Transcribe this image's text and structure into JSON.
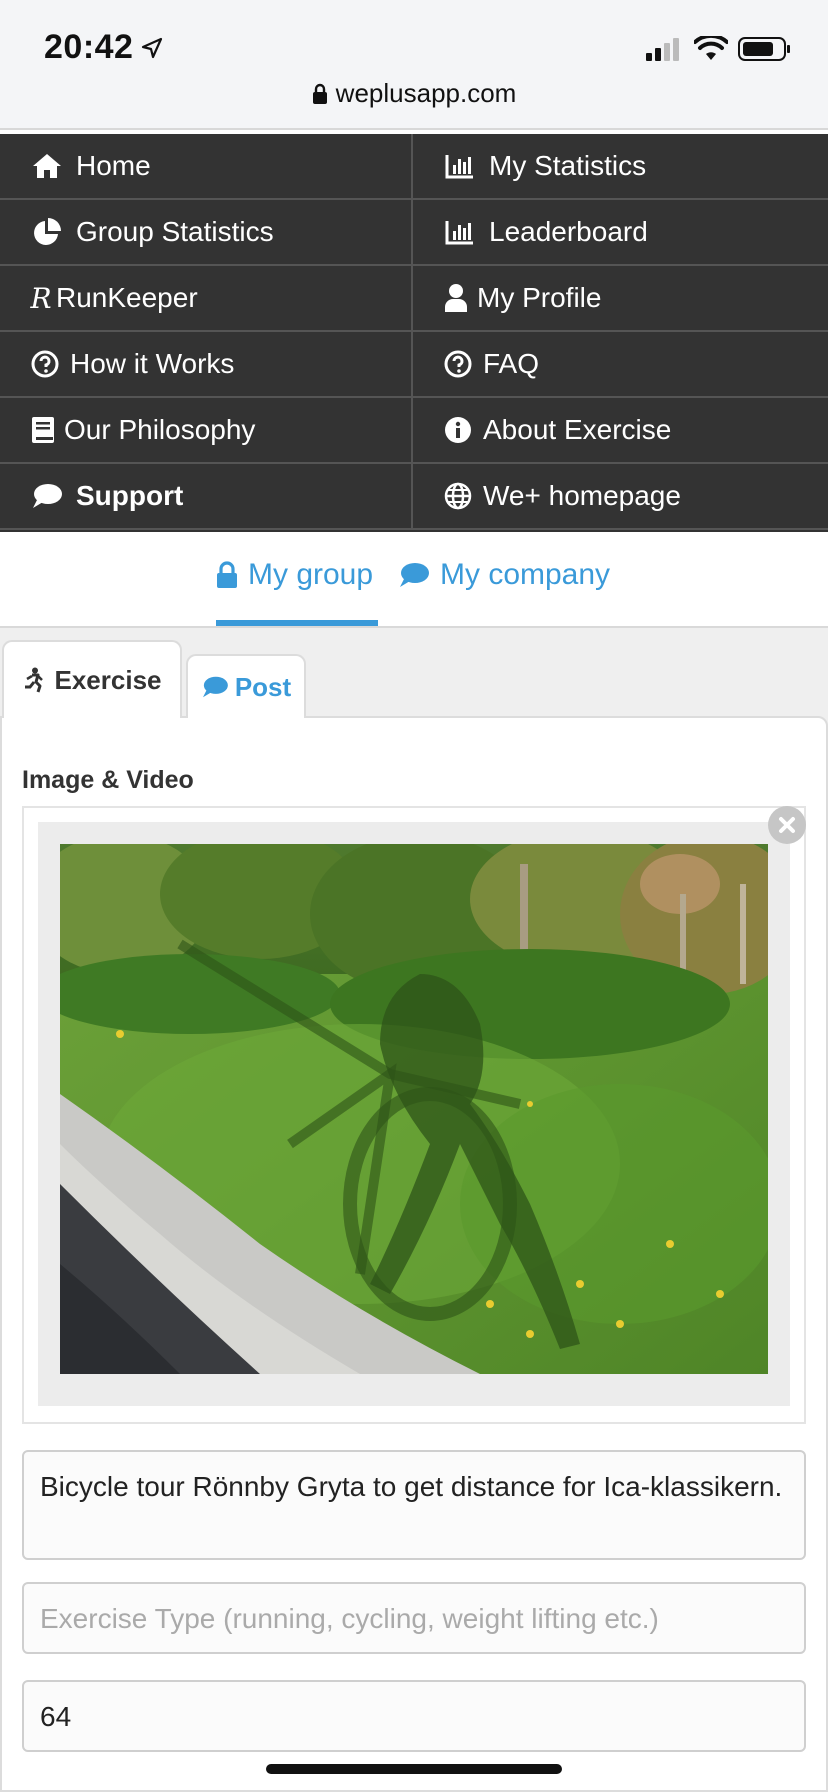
{
  "status_bar": {
    "time": "20:42",
    "url": "weplusapp.com",
    "icons": [
      "location-arrow-icon",
      "signal-icon",
      "wifi-icon",
      "battery-icon",
      "lock-icon"
    ]
  },
  "nav": {
    "items": [
      {
        "label": "Home",
        "icon": "home-icon"
      },
      {
        "label": "My Statistics",
        "icon": "bar-chart-icon"
      },
      {
        "label": "Group Statistics",
        "icon": "pie-chart-icon"
      },
      {
        "label": "Leaderboard",
        "icon": "bar-chart-icon"
      },
      {
        "label": "RunKeeper",
        "icon": "runkeeper-r-icon"
      },
      {
        "label": "My Profile",
        "icon": "user-icon"
      },
      {
        "label": "How it Works",
        "icon": "question-circle-icon"
      },
      {
        "label": "FAQ",
        "icon": "question-circle-icon"
      },
      {
        "label": "Our Philosophy",
        "icon": "book-icon"
      },
      {
        "label": "About Exercise",
        "icon": "info-circle-icon"
      },
      {
        "label": "Support",
        "icon": "comment-icon"
      },
      {
        "label": "We+ homepage",
        "icon": "globe-icon"
      }
    ]
  },
  "group_tabs": {
    "my_group": "My group",
    "my_company": "My company",
    "active": "My group"
  },
  "form_tabs": {
    "exercise": "Exercise",
    "post": "Post",
    "active": "Exercise"
  },
  "form": {
    "media_label": "Image & Video",
    "description_value": "Bicycle tour Rönnby Gryta to get distance for Ica-klassikern.",
    "exercise_type_placeholder": "Exercise Type (running, cycling, weight lifting etc.)",
    "distance_value": "64"
  },
  "colors": {
    "accent": "#3a9ad9",
    "nav_bg": "#333333",
    "nav_text": "#ffffff"
  }
}
